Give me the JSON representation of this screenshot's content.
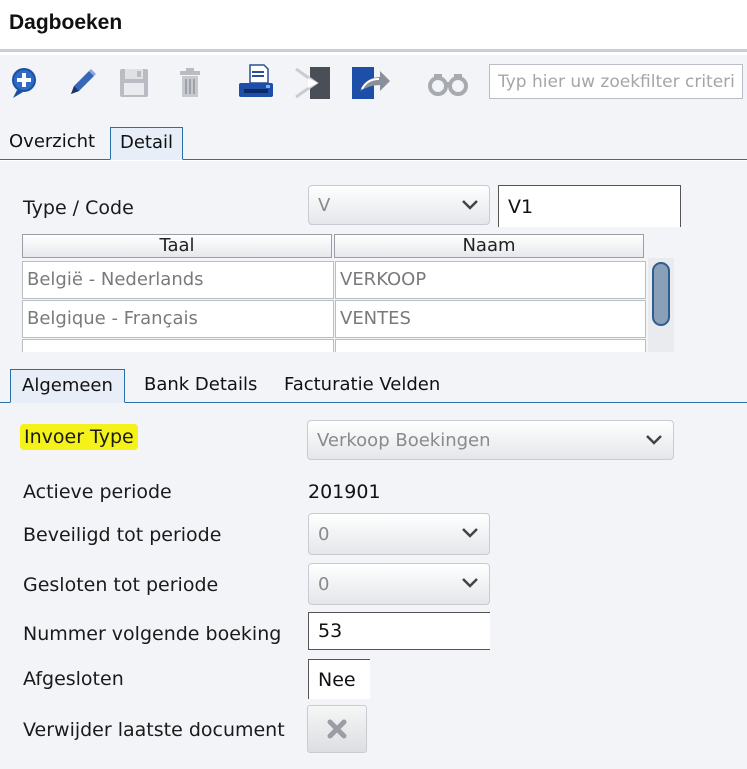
{
  "window": {
    "title": "Dagboeken"
  },
  "toolbar": {
    "buttons": [
      {
        "name": "add",
        "icon": "plus-circle-icon"
      },
      {
        "name": "edit",
        "icon": "pencil-icon"
      },
      {
        "name": "save",
        "icon": "floppy-disk-icon"
      },
      {
        "name": "delete",
        "icon": "trash-icon"
      },
      {
        "name": "print",
        "icon": "printer-icon"
      },
      {
        "name": "import",
        "icon": "import-arrow-icon"
      },
      {
        "name": "export",
        "icon": "export-arrow-icon"
      },
      {
        "name": "search",
        "icon": "binoculars-icon"
      }
    ],
    "search_placeholder": "Typ hier uw zoekfilter criteria"
  },
  "tabs_top": [
    {
      "label": "Overzicht",
      "active": false
    },
    {
      "label": "Detail",
      "active": true
    }
  ],
  "detail": {
    "type_code_label": "Type / Code",
    "type_value": "V",
    "code_value": "V1",
    "grid": {
      "columns": [
        "Taal",
        "Naam"
      ],
      "rows": [
        {
          "taal": "België - Nederlands",
          "naam": "VERKOOP"
        },
        {
          "taal": "Belgique - Français",
          "naam": "VENTES"
        }
      ]
    }
  },
  "tabs_mid": [
    {
      "label": "Algemeen",
      "active": true
    },
    {
      "label": "Bank Details",
      "active": false
    },
    {
      "label": "Facturatie Velden",
      "active": false
    }
  ],
  "general": {
    "invoer_type_label": "Invoer Type",
    "invoer_type_value": "Verkoop Boekingen",
    "actieve_periode_label": "Actieve periode",
    "actieve_periode_value": "201901",
    "beveiligd_label": "Beveiligd tot periode",
    "beveiligd_value": "0",
    "gesloten_label": "Gesloten tot periode",
    "gesloten_value": "0",
    "nummer_label": "Nummer volgende boeking",
    "nummer_value": "53",
    "afgesloten_label": "Afgesloten",
    "afgesloten_value": "Nee",
    "verwijder_label": "Verwijder laatste document"
  },
  "colors": {
    "accent": "#2a6fa8",
    "highlight": "#f4f218",
    "panel": "#f2f4f8"
  }
}
